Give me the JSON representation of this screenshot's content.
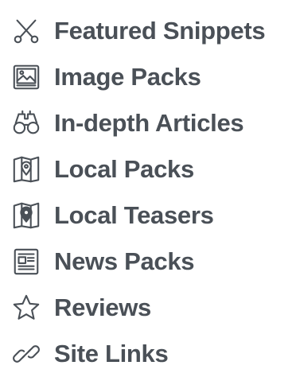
{
  "items": [
    {
      "label": "Featured Snippets",
      "icon": "scissors-icon"
    },
    {
      "label": "Image Packs",
      "icon": "image-icon"
    },
    {
      "label": "In-depth Articles",
      "icon": "binoculars-icon"
    },
    {
      "label": "Local Packs",
      "icon": "map-pin-icon"
    },
    {
      "label": "Local Teasers",
      "icon": "map-pin-filled-icon"
    },
    {
      "label": "News Packs",
      "icon": "newspaper-icon"
    },
    {
      "label": "Reviews",
      "icon": "star-icon"
    },
    {
      "label": "Site Links",
      "icon": "link-icon"
    }
  ],
  "colors": {
    "text": "#4a5057",
    "icon": "#4a5057",
    "background": "#ffffff"
  }
}
